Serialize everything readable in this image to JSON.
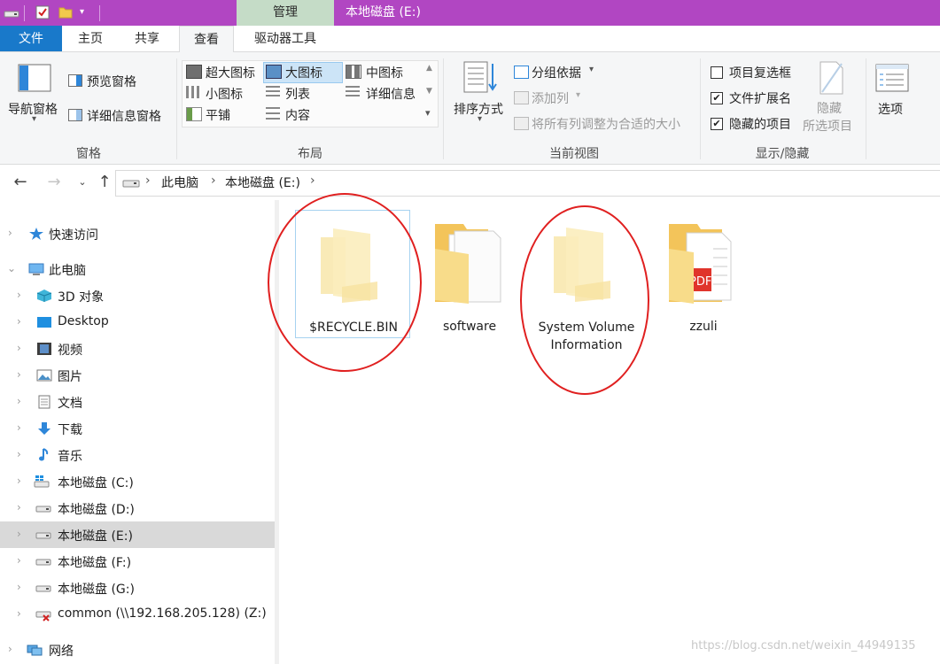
{
  "window": {
    "title": "本地磁盘 (E:)",
    "context_tab": "管理"
  },
  "ribbon_tabs": [
    "文件",
    "主页",
    "共享",
    "查看",
    "驱动器工具"
  ],
  "ribbon": {
    "panes": {
      "nav_pane": "导航窗格",
      "preview_pane": "预览窗格",
      "details_pane": "详细信息窗格",
      "group_label": "窗格"
    },
    "layout": {
      "items": [
        "超大图标",
        "大图标",
        "中图标",
        "小图标",
        "列表",
        "详细信息",
        "平铺",
        "内容"
      ],
      "selected": "大图标",
      "group_label": "布局"
    },
    "current_view": {
      "sort_by": "排序方式",
      "group_by": "分组依据",
      "add_columns": "添加列",
      "size_all_columns": "将所有列调整为合适的大小",
      "group_label": "当前视图"
    },
    "show_hide": {
      "item_checkboxes": "项目复选框",
      "item_checkboxes_checked": false,
      "file_extensions": "文件扩展名",
      "file_extensions_checked": true,
      "hidden_items": "隐藏的项目",
      "hidden_items_checked": true,
      "hide_selected_line1": "隐藏",
      "hide_selected_line2": "所选项目",
      "group_label": "显示/隐藏"
    },
    "options": "选项"
  },
  "address": {
    "crumbs": [
      "此电脑",
      "本地磁盘 (E:)"
    ]
  },
  "nav_pane": {
    "items": [
      {
        "label": "快速访问",
        "icon": "star-icon"
      },
      {
        "label": "此电脑",
        "icon": "computer-icon"
      },
      {
        "label": "3D 对象",
        "icon": "3d-objects-icon"
      },
      {
        "label": "Desktop",
        "icon": "desktop-icon"
      },
      {
        "label": "视频",
        "icon": "video-icon"
      },
      {
        "label": "图片",
        "icon": "pictures-icon"
      },
      {
        "label": "文档",
        "icon": "documents-icon"
      },
      {
        "label": "下载",
        "icon": "download-icon"
      },
      {
        "label": "音乐",
        "icon": "music-icon"
      },
      {
        "label": "本地磁盘 (C:)",
        "icon": "windows-drive-icon"
      },
      {
        "label": "本地磁盘 (D:)",
        "icon": "drive-icon"
      },
      {
        "label": "本地磁盘 (E:)",
        "icon": "drive-icon"
      },
      {
        "label": "本地磁盘 (F:)",
        "icon": "drive-icon"
      },
      {
        "label": "本地磁盘 (G:)",
        "icon": "drive-icon"
      },
      {
        "label": "common (\\\\192.168.205.128) (Z:)",
        "icon": "network-drive-disconnected-icon"
      },
      {
        "label": "网络",
        "icon": "network-icon"
      }
    ],
    "selected": "本地磁盘 (E:)"
  },
  "files": [
    {
      "name": "$RECYCLE.BIN",
      "icon": "hidden-folder-icon"
    },
    {
      "name": "software",
      "icon": "folder-with-files-icon"
    },
    {
      "name": "System Volume",
      "name_line2": "Information",
      "icon": "hidden-folder-icon"
    },
    {
      "name": "zzuli",
      "icon": "folder-with-pdf-icon"
    }
  ],
  "watermark": "https://blog.csdn.net/weixin_44949135",
  "colors": {
    "titlebar": "#b146c2",
    "context_tab": "#c5dcc7",
    "file_tab": "#1979ca",
    "selection": "#d9d9d9",
    "annotation": "#e02020"
  }
}
